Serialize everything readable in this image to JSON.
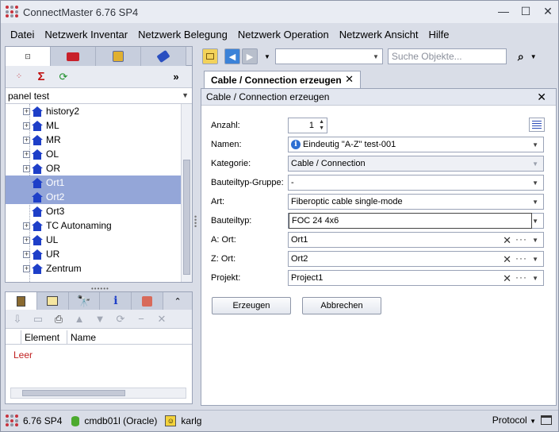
{
  "window": {
    "title": "ConnectMaster 6.76 SP4"
  },
  "menu": [
    "Datei",
    "Netzwerk Inventar",
    "Netzwerk Belegung",
    "Netzwerk Operation",
    "Netzwerk Ansicht",
    "Hilfe"
  ],
  "left_panel": {
    "combo_value": "panel test",
    "tree": [
      {
        "label": "history2",
        "selected": false,
        "expandable": true
      },
      {
        "label": "ML",
        "selected": false,
        "expandable": true
      },
      {
        "label": "MR",
        "selected": false,
        "expandable": true
      },
      {
        "label": "OL",
        "selected": false,
        "expandable": true
      },
      {
        "label": "OR",
        "selected": false,
        "expandable": true
      },
      {
        "label": "Ort1",
        "selected": true,
        "expandable": false
      },
      {
        "label": "Ort2",
        "selected": true,
        "expandable": false
      },
      {
        "label": "Ort3",
        "selected": false,
        "expandable": false
      },
      {
        "label": "TC Autonaming",
        "selected": false,
        "expandable": true
      },
      {
        "label": "UL",
        "selected": false,
        "expandable": true
      },
      {
        "label": "UR",
        "selected": false,
        "expandable": true
      },
      {
        "label": "Zentrum",
        "selected": false,
        "expandable": true
      }
    ]
  },
  "left_bottom": {
    "columns": [
      "Element",
      "Name"
    ],
    "empty_text": "Leer"
  },
  "right_toolbar": {
    "search_placeholder": "Suche Objekte..."
  },
  "doc_tab": {
    "label": "Cable / Connection erzeugen"
  },
  "form": {
    "header": "Cable / Connection erzeugen",
    "fields": {
      "anzahl": {
        "label": "Anzahl:",
        "value": "1"
      },
      "namen": {
        "label": "Namen:",
        "value": "Eindeutig \"A-Z\" test-001"
      },
      "kategorie": {
        "label": "Kategorie:",
        "value": "Cable / Connection"
      },
      "bauteiltyp_gruppe": {
        "label": "Bauteiltyp-Gruppe:",
        "value": "-"
      },
      "art": {
        "label": "Art:",
        "value": "Fiberoptic cable single-mode"
      },
      "bauteiltyp": {
        "label": "Bauteiltyp:",
        "value": "FOC 24 4x6"
      },
      "a_ort": {
        "label": "A: Ort:",
        "value": "Ort1"
      },
      "z_ort": {
        "label": "Z: Ort:",
        "value": "Ort2"
      },
      "projekt": {
        "label": "Projekt:",
        "value": "Project1"
      }
    },
    "buttons": {
      "create": "Erzeugen",
      "cancel": "Abbrechen"
    }
  },
  "statusbar": {
    "version": "6.76 SP4",
    "database": "cmdb01l (Oracle)",
    "user": "karlg",
    "protocol": "Protocol"
  },
  "colors": {
    "selection": "#94a6d8",
    "tree_icon": "#1e3fc8",
    "empty_text": "#c02020",
    "app_icon": "#c8323c"
  },
  "icons": [
    "app-logo-icon",
    "sigma-icon",
    "refresh-icon",
    "binoculars-icon",
    "info-icon",
    "database-icon",
    "user-icon",
    "list-icon"
  ]
}
